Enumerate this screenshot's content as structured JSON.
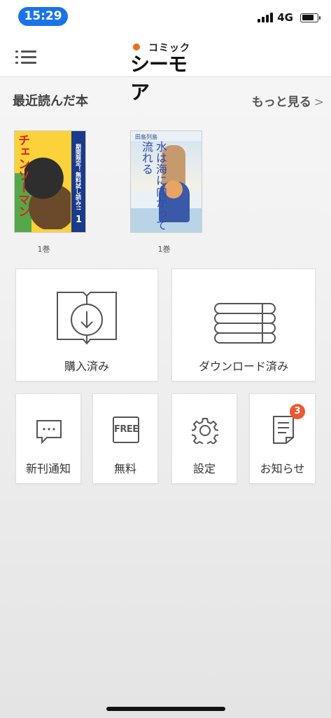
{
  "status_bar": {
    "time": "15:29",
    "network": "4G"
  },
  "header": {
    "logo_small": "コミック",
    "logo_big": "シーモア"
  },
  "recent": {
    "title": "最近読んだ本",
    "more_label": "もっと見る",
    "more_chevron": ">",
    "books": [
      {
        "volume": "1巻",
        "cover_title": "チェンソーマン",
        "band_text": "期間限定！無料試し読み!!",
        "cover_number": "1"
      },
      {
        "volume": "1巻",
        "cover_author": "田島列島",
        "cover_title": "水は海に向かって流れる"
      }
    ]
  },
  "main_tiles": [
    {
      "label": "購入済み",
      "icon": "book-download-icon"
    },
    {
      "label": "ダウンロード済み",
      "icon": "stack-icon"
    }
  ],
  "small_tiles": [
    {
      "label": "新刊通知",
      "icon": "chat-bubble-icon"
    },
    {
      "label": "無料",
      "icon": "free-icon",
      "icon_text": "FREE"
    },
    {
      "label": "設定",
      "icon": "gear-icon"
    },
    {
      "label": "お知らせ",
      "icon": "document-icon",
      "badge": "3"
    }
  ],
  "colors": {
    "accent": "#ee6e1c",
    "badge": "#ea5a33",
    "time_pill": "#1a73e8"
  }
}
